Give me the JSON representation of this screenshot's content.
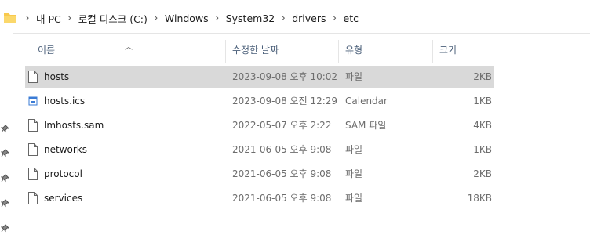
{
  "breadcrumb": {
    "items": [
      "내 PC",
      "로컬 디스크 (C:)",
      "Windows",
      "System32",
      "drivers",
      "etc"
    ],
    "separator": ">"
  },
  "columns": {
    "name": "이름",
    "date": "수정한 날짜",
    "type": "유형",
    "size": "크기"
  },
  "files": [
    {
      "name": "hosts",
      "date": "2023-09-08 오후 10:02",
      "type": "파일",
      "size": "2KB",
      "icon": "file-icon",
      "selected": true
    },
    {
      "name": "hosts.ics",
      "date": "2023-09-08 오전 12:29",
      "type": "Calendar",
      "size": "1KB",
      "icon": "calendar-file-icon",
      "selected": false
    },
    {
      "name": "lmhosts.sam",
      "date": "2022-05-07 오후 2:22",
      "type": "SAM 파일",
      "size": "4KB",
      "icon": "file-icon",
      "selected": false
    },
    {
      "name": "networks",
      "date": "2021-06-05 오후 9:08",
      "type": "파일",
      "size": "1KB",
      "icon": "file-icon",
      "selected": false
    },
    {
      "name": "protocol",
      "date": "2021-06-05 오후 9:08",
      "type": "파일",
      "size": "2KB",
      "icon": "file-icon",
      "selected": false
    },
    {
      "name": "services",
      "date": "2021-06-05 오후 9:08",
      "type": "파일",
      "size": "18KB",
      "icon": "file-icon",
      "selected": false
    }
  ],
  "colors": {
    "selected_row": "#d9d9d9",
    "header_text": "#4c607a",
    "folder_yellow": "#f8c94d"
  }
}
